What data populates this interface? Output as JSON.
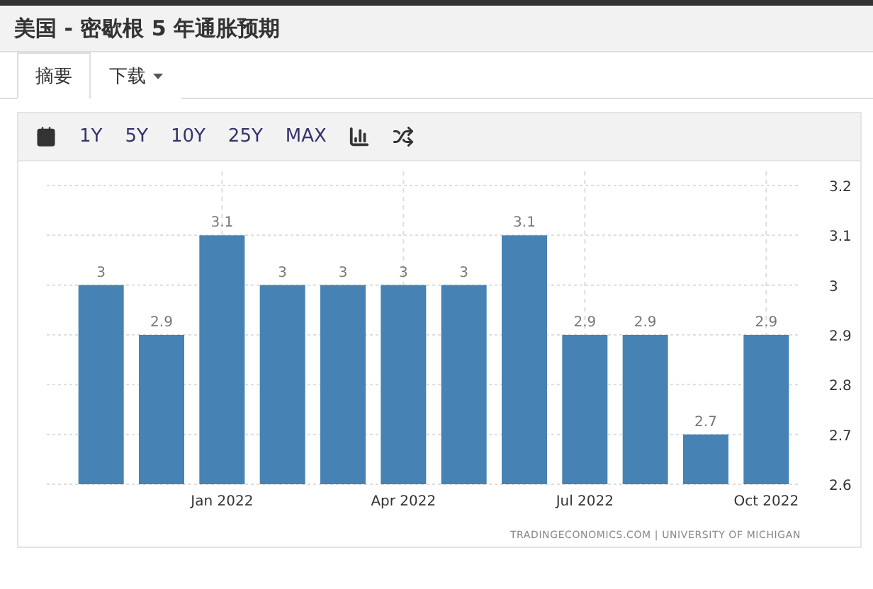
{
  "title": "美国 - 密歇根 5 年通胀预期",
  "tabs": [
    {
      "label": "摘要",
      "selected": true,
      "dropdown": false
    },
    {
      "label": "下载",
      "selected": false,
      "dropdown": true
    }
  ],
  "toolbar": [
    {
      "kind": "calendar"
    },
    {
      "kind": "range",
      "label": "1Y"
    },
    {
      "kind": "range",
      "label": "5Y"
    },
    {
      "kind": "range",
      "label": "10Y"
    },
    {
      "kind": "range",
      "label": "25Y"
    },
    {
      "kind": "range",
      "label": "MAX"
    },
    {
      "kind": "bars"
    },
    {
      "kind": "shuffle"
    }
  ],
  "chart": {
    "chart_data": {
      "type": "bar",
      "grid": true,
      "categories": [
        null,
        null,
        "Jan 2022",
        null,
        null,
        "Apr 2022",
        null,
        null,
        "Jul 2022",
        null,
        null,
        "Oct 2022"
      ],
      "series": [
        {
          "color": "#4682b4",
          "values": [
            3,
            2.9,
            3.1,
            3,
            3,
            3,
            3,
            3.1,
            2.9,
            2.9,
            2.7,
            2.9
          ]
        }
      ],
      "value_labels": [
        "3",
        "2.9",
        "3.1",
        "3",
        "3",
        "3",
        "3",
        "3.1",
        "2.9",
        "2.9",
        "2.7",
        "2.9"
      ],
      "ylim": [
        2.6,
        3.2
      ],
      "yticks": [
        {
          "value": 2.6,
          "label": "2.6"
        },
        {
          "value": 2.7,
          "label": "2.7"
        },
        {
          "value": 2.8,
          "label": "2.8"
        },
        {
          "value": 2.9,
          "label": "2.9"
        },
        {
          "value": 3,
          "label": "3"
        },
        {
          "value": 3.1,
          "label": "3.1"
        },
        {
          "value": 3.2,
          "label": "3.2"
        }
      ]
    },
    "source": "TRADINGECONOMICS.COM  |  UNIVERSITY OF MICHIGAN"
  }
}
